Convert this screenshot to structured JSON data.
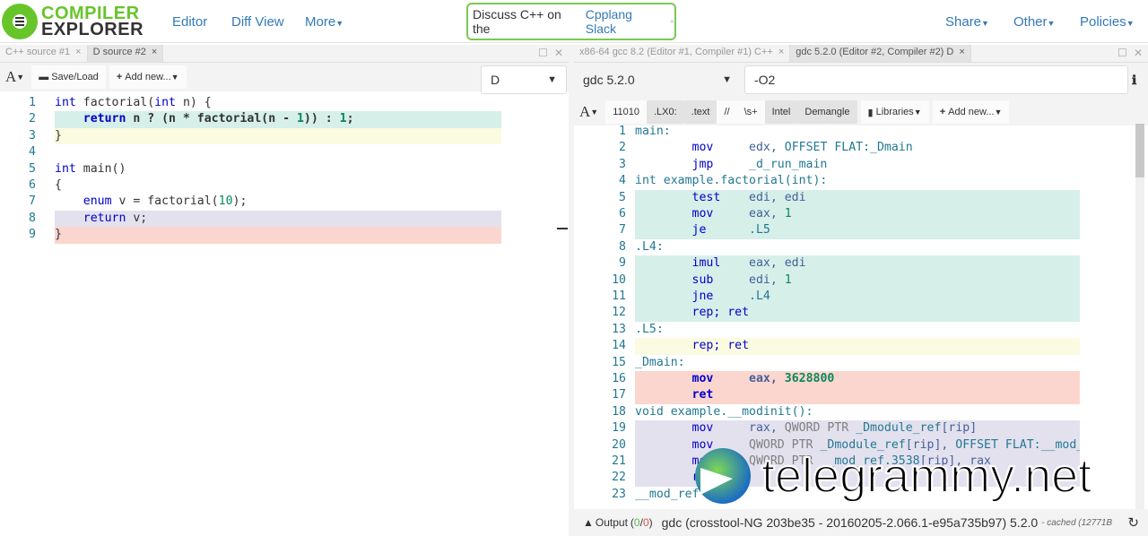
{
  "header": {
    "logo_line1": "COMPILER",
    "logo_line2": "EXPLORER",
    "nav": [
      "Editor",
      "Diff View",
      "More"
    ],
    "motd_text": "Discuss C++ on the",
    "motd_link": "Cpplang Slack",
    "right_nav": [
      "Share",
      "Other",
      "Policies"
    ]
  },
  "left": {
    "tabs": [
      "C++ source #1",
      "D source #2"
    ],
    "font_btn": "A",
    "save_load": "Save/Load",
    "add_new": "Add new...",
    "language": "D",
    "lines": [
      {
        "hl": "",
        "t": [
          [
            "kw",
            "int"
          ],
          [
            "fn",
            " factorial("
          ],
          [
            "kw",
            "int"
          ],
          [
            "fn",
            " n) {"
          ]
        ]
      },
      {
        "hl": "hl1",
        "t": [
          [
            "fn",
            "    "
          ],
          [
            "kw b",
            "return"
          ],
          [
            "fn b",
            " n ? (n * factorial(n - "
          ],
          [
            "nm b",
            "1"
          ],
          [
            "fn b",
            ")) : "
          ],
          [
            "nm b",
            "1"
          ],
          [
            "fn b",
            ";"
          ]
        ]
      },
      {
        "hl": "hl2",
        "t": [
          [
            "fn",
            "}"
          ]
        ]
      },
      {
        "hl": "",
        "t": []
      },
      {
        "hl": "",
        "t": [
          [
            "kw",
            "int"
          ],
          [
            "fn",
            " main()"
          ]
        ]
      },
      {
        "hl": "",
        "t": [
          [
            "fn",
            "{"
          ]
        ]
      },
      {
        "hl": "",
        "t": [
          [
            "fn",
            "    "
          ],
          [
            "kw",
            "enum"
          ],
          [
            "fn",
            " v = factorial("
          ],
          [
            "nm",
            "10"
          ],
          [
            "fn",
            ");"
          ]
        ]
      },
      {
        "hl": "hl3",
        "t": [
          [
            "fn",
            "    "
          ],
          [
            "kw",
            "return"
          ],
          [
            "fn",
            " v;"
          ]
        ]
      },
      {
        "hl": "hl4",
        "t": [
          [
            "fn",
            "}"
          ]
        ]
      }
    ]
  },
  "right": {
    "tabs": [
      "x86-64 gcc 8.2 (Editor #1, Compiler #1) C++",
      "gdc 5.2.0 (Editor #2, Compiler #2) D"
    ],
    "compiler": "gdc 5.2.0",
    "options": "-O2",
    "filters": [
      "11010",
      ".LX0:",
      ".text",
      "//",
      "\\s+",
      "Intel",
      "Demangle"
    ],
    "libraries": "Libraries",
    "add_new": "Add new...",
    "font_btn": "A",
    "lines": [
      {
        "hl": "",
        "t": [
          [
            "lbl",
            "main:"
          ]
        ]
      },
      {
        "hl": "",
        "t": [
          [
            "op",
            "        mov"
          ],
          [
            "reg",
            "     edx, "
          ],
          [
            "lbl",
            "OFFSET FLAT:_Dmain"
          ]
        ]
      },
      {
        "hl": "",
        "t": [
          [
            "op",
            "        jmp"
          ],
          [
            "lbl",
            "     _d_run_main"
          ]
        ]
      },
      {
        "hl": "",
        "t": [
          [
            "lbl",
            "int example.factorial(int):"
          ]
        ]
      },
      {
        "hl": "hl1",
        "t": [
          [
            "op",
            "        test"
          ],
          [
            "reg",
            "    edi, edi"
          ]
        ]
      },
      {
        "hl": "hl1",
        "t": [
          [
            "op",
            "        mov"
          ],
          [
            "reg",
            "     eax, "
          ],
          [
            "nm",
            "1"
          ]
        ]
      },
      {
        "hl": "hl1",
        "t": [
          [
            "op",
            "        je"
          ],
          [
            "lbl",
            "      .L5"
          ]
        ]
      },
      {
        "hl": "",
        "t": [
          [
            "lbl",
            ".L4:"
          ]
        ]
      },
      {
        "hl": "hl1",
        "t": [
          [
            "op",
            "        imul"
          ],
          [
            "reg",
            "    eax, edi"
          ]
        ]
      },
      {
        "hl": "hl1",
        "t": [
          [
            "op",
            "        sub"
          ],
          [
            "reg",
            "     edi, "
          ],
          [
            "nm",
            "1"
          ]
        ]
      },
      {
        "hl": "hl1",
        "t": [
          [
            "op",
            "        jne"
          ],
          [
            "lbl",
            "     .L4"
          ]
        ]
      },
      {
        "hl": "hl1",
        "t": [
          [
            "op",
            "        rep; ret"
          ]
        ]
      },
      {
        "hl": "",
        "t": [
          [
            "lbl",
            ".L5:"
          ]
        ]
      },
      {
        "hl": "hl2",
        "t": [
          [
            "op",
            "        rep; ret"
          ]
        ]
      },
      {
        "hl": "",
        "t": [
          [
            "lbl",
            "_Dmain:"
          ]
        ]
      },
      {
        "hl": "hl4",
        "t": [
          [
            "op b",
            "        mov"
          ],
          [
            "reg b",
            "     eax, "
          ],
          [
            "nm b",
            "3628800"
          ]
        ]
      },
      {
        "hl": "hl4",
        "t": [
          [
            "op b",
            "        ret"
          ]
        ]
      },
      {
        "hl": "",
        "t": [
          [
            "lbl",
            "void example.__modinit():"
          ]
        ]
      },
      {
        "hl": "hl3",
        "t": [
          [
            "op",
            "        mov"
          ],
          [
            "reg",
            "     rax, "
          ],
          [
            "cm",
            "QWORD PTR "
          ],
          [
            "lbl",
            "_Dmodule_ref"
          ],
          [
            "reg",
            "[rip]"
          ]
        ]
      },
      {
        "hl": "hl3",
        "t": [
          [
            "op",
            "        mov"
          ],
          [
            "cm",
            "     QWORD PTR "
          ],
          [
            "lbl",
            "_Dmodule_ref"
          ],
          [
            "reg",
            "[rip], "
          ],
          [
            "lbl",
            "OFFSET FLAT:__mod_r"
          ]
        ]
      },
      {
        "hl": "hl3",
        "t": [
          [
            "op",
            "        mov"
          ],
          [
            "cm",
            "     QWORD PTR "
          ],
          [
            "lbl",
            "__mod_ref.3538"
          ],
          [
            "reg",
            "[rip], rax"
          ]
        ]
      },
      {
        "hl": "hl3",
        "t": [
          [
            "op",
            "        ret"
          ]
        ]
      },
      {
        "hl": "",
        "t": [
          [
            "lbl",
            "__mod_ref"
          ]
        ]
      }
    ]
  },
  "status": {
    "output_label": "Output",
    "output_ok": "0",
    "output_err": "0",
    "compiler_info": "gdc (crosstool-NG 203be35 - 20160205-2.066.1-e95a735b97) 5.2.0",
    "cached": "- cached (12771B"
  },
  "watermark": "telegrammy.net"
}
